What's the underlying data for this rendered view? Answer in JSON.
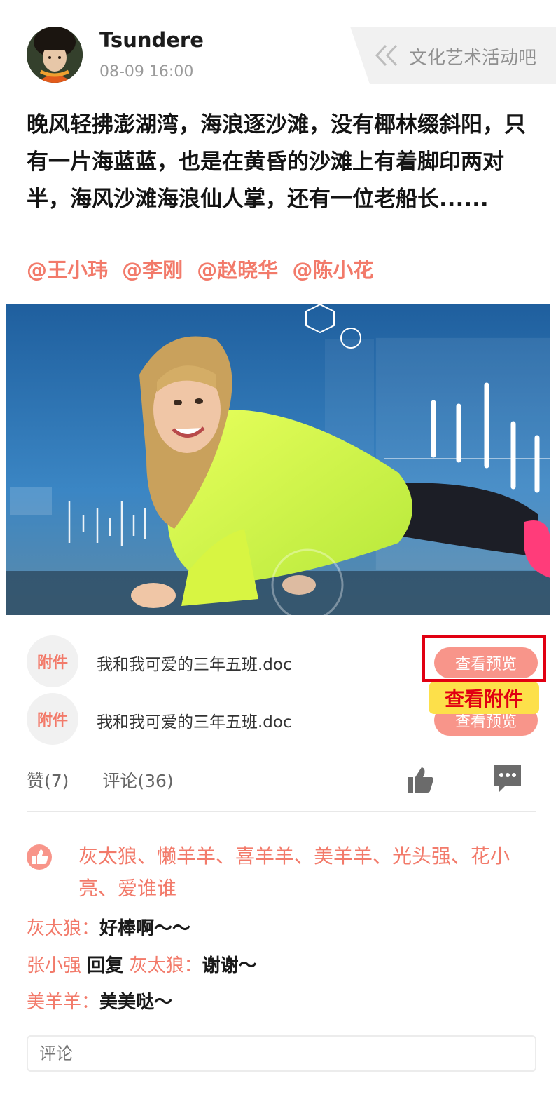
{
  "post": {
    "author": "Tsundere",
    "time": "08-09 16:00",
    "group": "文化艺术活动吧",
    "text": "晚风轻拂澎湖湾，海浪逐沙滩，没有椰林缀斜阳，只有一片海蓝蓝，也是在黄昏的沙滩上有着脚印两对半，海风沙滩海浪仙人掌，还有一位老船长......",
    "mentions": [
      "@王小玮",
      "@李刚",
      "@赵晓华",
      "@陈小花"
    ]
  },
  "attachments": [
    {
      "badge": "附件",
      "filename": "我和我可爱的三年五班.doc",
      "button": "查看预览"
    },
    {
      "badge": "附件",
      "filename": "我和我可爱的三年五班.doc",
      "button": "查看预览"
    }
  ],
  "annotation": {
    "tooltip": "查看附件"
  },
  "stats": {
    "likes": "赞(7)",
    "comments": "评论(36)"
  },
  "likes_list": "灰太狼、懒羊羊、喜羊羊、美羊羊、光头强、花小亮、爱谁谁",
  "comments": [
    {
      "user": "灰太狼",
      "sep": "：",
      "text": "好棒啊～～"
    },
    {
      "user": "张小强",
      "reply_word": "回复",
      "reply_to": "灰太狼",
      "sep": "：",
      "text": "谢谢～"
    },
    {
      "user": "美羊羊",
      "sep": "：",
      "text": "美美哒～"
    }
  ],
  "input": {
    "placeholder": "评论"
  },
  "colors": {
    "accent": "#f27a6a",
    "button": "#f8958a",
    "highlight": "#e10012",
    "tooltip_bg": "#fde04a"
  },
  "icons": [
    "chevron-double-left-icon",
    "thumbs-up-icon",
    "comment-icon",
    "like-badge-icon"
  ]
}
